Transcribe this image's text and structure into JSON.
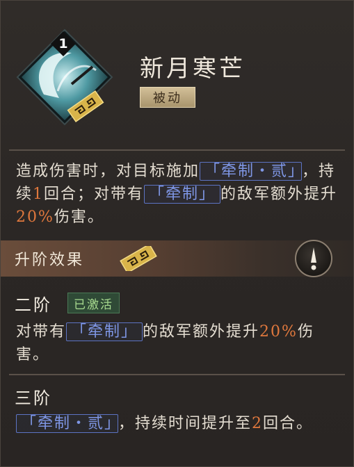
{
  "skill": {
    "level": "1",
    "title": "新月寒芒",
    "type": "被动",
    "icon": "crescent-wave-skill-icon"
  },
  "description": {
    "part1": "造成伤害时，对目标施加",
    "keyword1": "「牵制・贰」",
    "part2": "，持续",
    "num1": "1",
    "part3": "回合；对带有",
    "keyword2": "「牵制」",
    "part4": "的敌军额外提升",
    "num2": "20%",
    "part5": "伤害。"
  },
  "upgrade": {
    "title": "升阶效果",
    "info_icon": "exclamation-icon"
  },
  "stages": [
    {
      "name": "二阶",
      "status": "已激活",
      "text1": "对带有",
      "keyword": "「牵制」",
      "text2": "的敌军额外提升",
      "num": "20%",
      "text3": "伤害。"
    },
    {
      "name": "三阶",
      "keyword": "「牵制・贰」",
      "text1": "，持续时间提升至",
      "num": "2",
      "text2": "回合。"
    }
  ],
  "colors": {
    "keyword": "#7f97e6",
    "number": "#e0783d",
    "active": "#a9dc90",
    "gold": "#d4b04a"
  }
}
